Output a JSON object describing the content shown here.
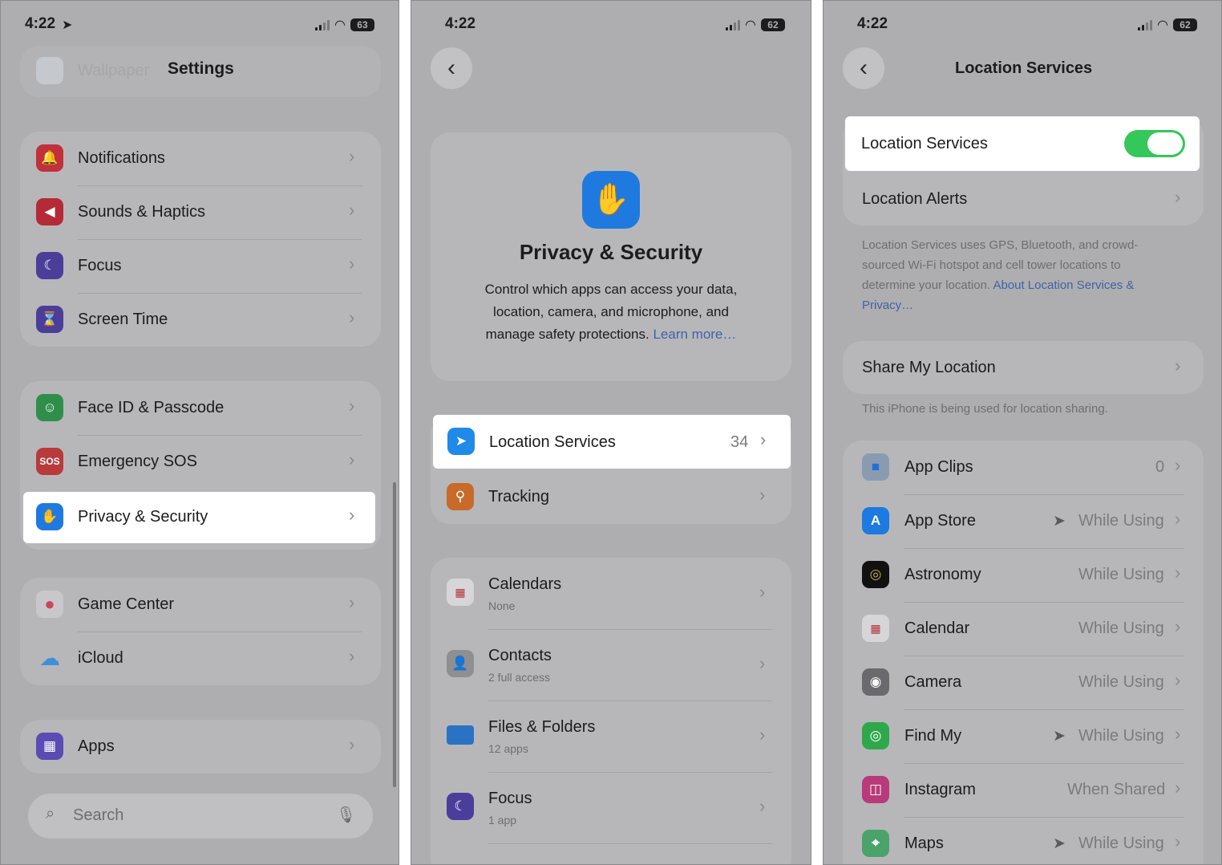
{
  "panel1": {
    "time": "4:22",
    "battery": "63",
    "back_label": "Wallpaper",
    "title": "Settings",
    "group1": [
      {
        "label": "Notifications"
      },
      {
        "label": "Sounds & Haptics"
      },
      {
        "label": "Focus"
      },
      {
        "label": "Screen Time"
      }
    ],
    "group2": [
      {
        "label": "Face ID & Passcode"
      },
      {
        "label": "Emergency SOS",
        "icon_text": "SOS"
      },
      {
        "label": "Privacy & Security"
      }
    ],
    "group3": [
      {
        "label": "Game Center"
      },
      {
        "label": "iCloud"
      }
    ],
    "group4": [
      {
        "label": "Apps"
      }
    ],
    "search_placeholder": "Search"
  },
  "panel2": {
    "time": "4:22",
    "battery": "62",
    "header_title": "Privacy & Security",
    "header_desc_1": "Control which apps can access your data,",
    "header_desc_2": "location, camera, and microphone, and",
    "header_desc_3": "manage safety protections.",
    "learn_more": "Learn more…",
    "location_services": {
      "label": "Location Services",
      "value": "34"
    },
    "tracking": {
      "label": "Tracking"
    },
    "items": [
      {
        "label": "Calendars",
        "sub": "None"
      },
      {
        "label": "Contacts",
        "sub": "2 full access"
      },
      {
        "label": "Files & Folders",
        "sub": "12 apps"
      },
      {
        "label": "Focus",
        "sub": "1 app"
      }
    ]
  },
  "panel3": {
    "time": "4:22",
    "battery": "62",
    "title": "Location Services",
    "toggle_label": "Location Services",
    "toggle_on": true,
    "location_alerts": "Location Alerts",
    "footnote_1": "Location Services uses GPS, Bluetooth, and crowd-",
    "footnote_2": "sourced Wi-Fi hotspot and cell tower locations to",
    "footnote_3": "determine your location.",
    "footnote_link_1": "About Location Services &",
    "footnote_link_2": "Privacy…",
    "share_my_location": "Share My Location",
    "share_note": "This iPhone is being used for location sharing.",
    "apps": [
      {
        "label": "App Clips",
        "value": "0",
        "arrow": false
      },
      {
        "label": "App Store",
        "value": "While Using",
        "arrow": true
      },
      {
        "label": "Astronomy",
        "value": "While Using",
        "arrow": false
      },
      {
        "label": "Calendar",
        "value": "While Using",
        "arrow": false
      },
      {
        "label": "Camera",
        "value": "While Using",
        "arrow": false
      },
      {
        "label": "Find My",
        "value": "While Using",
        "arrow": true
      },
      {
        "label": "Instagram",
        "value": "When Shared",
        "arrow": false
      },
      {
        "label": "Maps",
        "value": "While Using",
        "arrow": true
      }
    ]
  },
  "colors": {
    "dim_background": "#aeaeb0",
    "toggle_on": "#34c759",
    "link": "#3e63a8",
    "privacy_blue": "#1f7ae0"
  }
}
